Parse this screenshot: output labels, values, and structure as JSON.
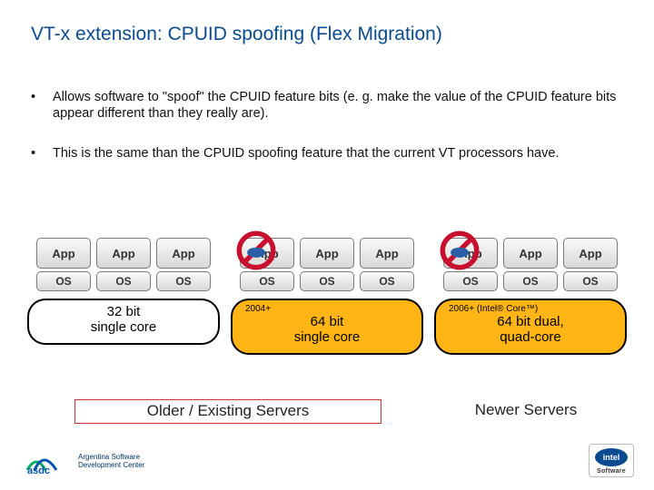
{
  "title": "VT-x extension:  CPUID spoofing (Flex Migration)",
  "bullets": [
    "Allows software to \"spoof\" the CPUID feature bits (e. g. make the value of the CPUID feature bits appear different than they really are).",
    "This is the same than the CPUID spoofing feature that the current VT processors have."
  ],
  "vm": {
    "app": "App",
    "os": "OS"
  },
  "groups": [
    {
      "year": "",
      "label": "32 bit\nsingle core",
      "style": "w",
      "prohibit": false
    },
    {
      "year": "2004+",
      "label": "64 bit\nsingle core",
      "style": "y",
      "prohibit": true
    },
    {
      "year": "2006+ (Intel® Core™)",
      "label": "64 bit dual,\nquad-core",
      "style": "y",
      "prohibit": true
    }
  ],
  "captions": {
    "old": "Older / Existing Servers",
    "new": "Newer Servers"
  },
  "footer": {
    "asdc_line1": "Argentina Software",
    "asdc_line2": "Development Center",
    "intel_sub": "Software"
  }
}
